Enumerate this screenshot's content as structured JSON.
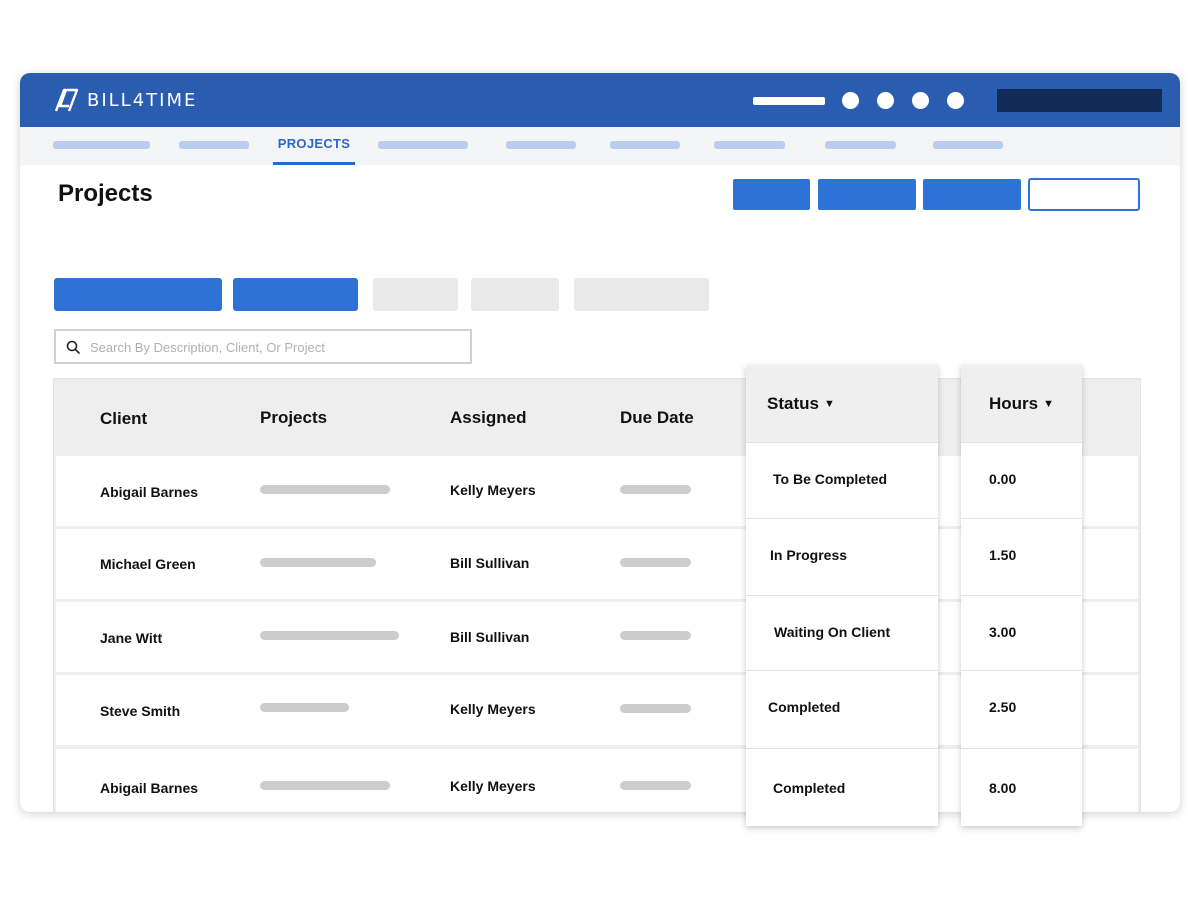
{
  "app": {
    "logo_text": "BILL4TIME",
    "brand_color": "#2a5db0",
    "accent_color": "#2f72d6"
  },
  "nav": {
    "active_tab": "PROJECTS"
  },
  "page": {
    "title": "Projects"
  },
  "search": {
    "placeholder": "Search By Description, Client, Or Project",
    "value": ""
  },
  "table": {
    "headers": {
      "client": "Client",
      "projects": "Projects",
      "assigned": "Assigned",
      "due_date": "Due Date",
      "status": "Status",
      "hours": "Hours"
    },
    "rows": [
      {
        "client": "Abigail Barnes",
        "assigned": "Kelly Meyers",
        "status": "To Be Completed",
        "hours": "0.00"
      },
      {
        "client": "Michael Green",
        "assigned": "Bill Sullivan",
        "status": "In Progress",
        "hours": "1.50"
      },
      {
        "client": "Jane Witt",
        "assigned": "Bill Sullivan",
        "status": "Waiting On Client",
        "hours": "3.00"
      },
      {
        "client": "Steve Smith",
        "assigned": "Kelly Meyers",
        "status": "Completed",
        "hours": "2.50"
      },
      {
        "client": "Abigail Barnes",
        "assigned": "Kelly Meyers",
        "status": "Completed",
        "hours": "8.00"
      }
    ]
  },
  "icons": {
    "sort": "caret-down-icon",
    "search": "search-icon",
    "logo": "bill4time-logo-icon"
  }
}
